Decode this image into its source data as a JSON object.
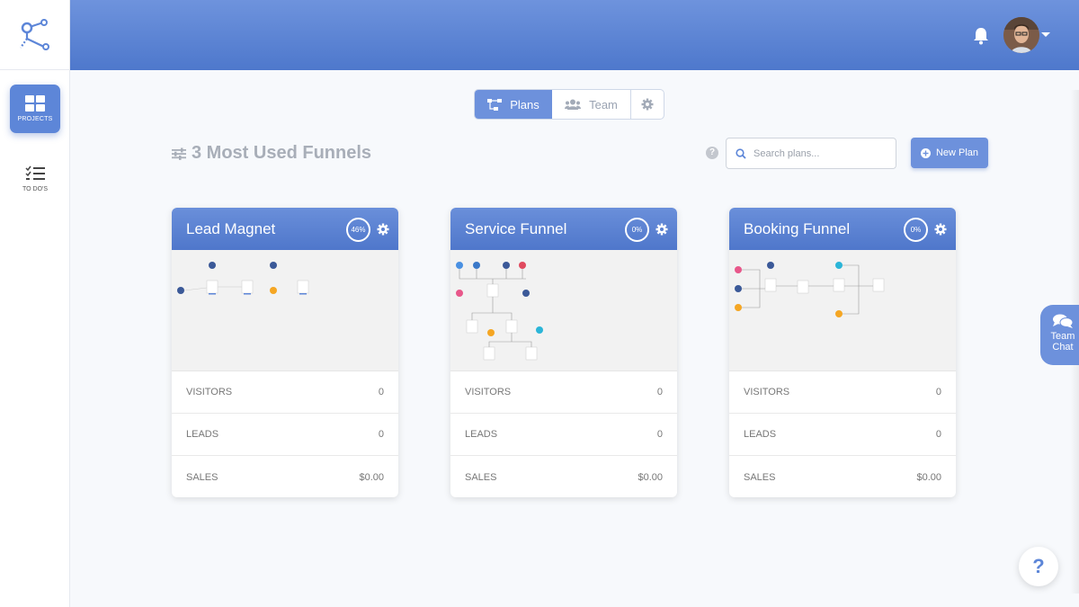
{
  "sidebar": {
    "logo_icon": "funnel-nodes-logo",
    "items": [
      {
        "label": "PROJECTS",
        "icon": "grid-icon",
        "active": true
      },
      {
        "label": "TO DO'S",
        "icon": "checklist-icon",
        "active": false
      }
    ]
  },
  "header": {
    "bell_icon": "bell-icon",
    "avatar_icon": "user-avatar"
  },
  "tabs": [
    {
      "label": "Plans",
      "icon": "sitemap-icon",
      "active": true
    },
    {
      "label": "Team",
      "icon": "users-icon",
      "active": false
    },
    {
      "label": "",
      "icon": "gear-icon",
      "active": false
    }
  ],
  "toolbar": {
    "heading": "3 Most Used Funnels",
    "search_placeholder": "Search plans...",
    "new_plan_label": "New Plan"
  },
  "cards": [
    {
      "title": "Lead Magnet",
      "progress": "46%",
      "stats": [
        {
          "label": "VISITORS",
          "value": "0"
        },
        {
          "label": "LEADS",
          "value": "0"
        },
        {
          "label": "SALES",
          "value": "$0.00"
        }
      ]
    },
    {
      "title": "Service Funnel",
      "progress": "0%",
      "stats": [
        {
          "label": "VISITORS",
          "value": "0"
        },
        {
          "label": "LEADS",
          "value": "0"
        },
        {
          "label": "SALES",
          "value": "$0.00"
        }
      ]
    },
    {
      "title": "Booking Funnel",
      "progress": "0%",
      "stats": [
        {
          "label": "VISITORS",
          "value": "0"
        },
        {
          "label": "LEADS",
          "value": "0"
        },
        {
          "label": "SALES",
          "value": "$0.00"
        }
      ]
    }
  ],
  "team_chat": {
    "line1": "Team",
    "line2": "Chat"
  },
  "help": {
    "label": "?"
  },
  "colors": {
    "accent": "#5d86d8",
    "header_top": "#6e93dd",
    "header_bottom": "#4e78cc"
  }
}
